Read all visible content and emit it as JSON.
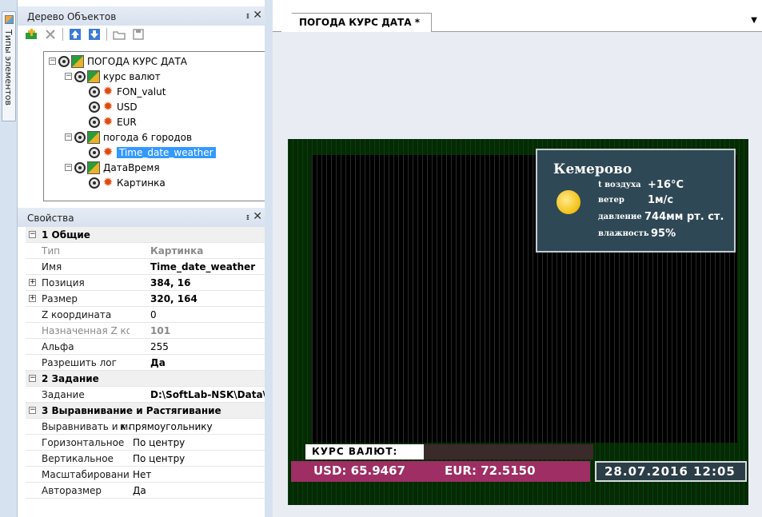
{
  "rail": {
    "label": "Типы элементов",
    "icon": "elements-icon"
  },
  "tree_panel": {
    "title": "Дерево Объектов",
    "pin": "ᵻ",
    "close": "✕",
    "toolbar": [
      "add-element-icon",
      "delete-icon",
      "move-up-icon",
      "move-down-icon",
      "open-icon",
      "save-icon"
    ],
    "nodes": [
      {
        "label": "ПОГОДА КУРС ДАТА",
        "level": 0,
        "expander": "−",
        "kind": "root"
      },
      {
        "label": "курс валют",
        "level": 1,
        "expander": "−",
        "kind": "group"
      },
      {
        "label": "FON_valut",
        "level": 2,
        "kind": "item"
      },
      {
        "label": "USD",
        "level": 2,
        "kind": "item"
      },
      {
        "label": "EUR",
        "level": 2,
        "kind": "item"
      },
      {
        "label": "погода 6 городов",
        "level": 1,
        "expander": "−",
        "kind": "group"
      },
      {
        "label": "Time_date_weather",
        "level": 2,
        "kind": "item",
        "selected": true
      },
      {
        "label": "ДатаВремя",
        "level": 1,
        "expander": "−",
        "kind": "group"
      },
      {
        "label": "Картинка",
        "level": 2,
        "kind": "item"
      }
    ]
  },
  "props_panel": {
    "title": "Свойства",
    "pin": "ᵻ",
    "close": "✕",
    "rows": [
      {
        "type": "cat",
        "name": "1 Общие",
        "expander": "−"
      },
      {
        "type": "prop",
        "name": "Тип",
        "value": "Картинка",
        "dim": true,
        "bold": true
      },
      {
        "type": "prop",
        "name": "Имя",
        "value": "Time_date_weather",
        "bold": true
      },
      {
        "type": "prop",
        "name": "Позиция",
        "value": "384, 16",
        "bold": true,
        "expander": "+"
      },
      {
        "type": "prop",
        "name": "Размер",
        "value": "320, 164",
        "bold": true,
        "expander": "+"
      },
      {
        "type": "prop",
        "name": "Z координата",
        "value": "0"
      },
      {
        "type": "prop",
        "name": "Назначенная Z коо",
        "value": "101",
        "dim": true,
        "bold": true
      },
      {
        "type": "prop",
        "name": "Альфа",
        "value": "255"
      },
      {
        "type": "prop",
        "name": "Разрешить лог",
        "value": "Да",
        "bold": true
      },
      {
        "type": "cat",
        "name": "2 Задание",
        "expander": "−"
      },
      {
        "type": "prop",
        "name": "Задание",
        "value": "D:\\SoftLab-NSK\\Data\\",
        "bold": true
      },
      {
        "type": "cat",
        "name": "3 Выравнивание и Растягивание",
        "expander": "−"
      },
      {
        "type": "prop",
        "name": "Выравнивать и мас",
        "value": "к прямоугольнику"
      },
      {
        "type": "prop",
        "name": "Горизонтальное",
        "value": "По центру"
      },
      {
        "type": "prop",
        "name": "Вертикальное",
        "value": "По центру"
      },
      {
        "type": "prop",
        "name": "Масштабирование",
        "value": "Нет"
      },
      {
        "type": "prop",
        "name": "Авторазмер",
        "value": "Да"
      }
    ]
  },
  "document": {
    "tab_label": "ПОГОДА КУРС ДАТА *",
    "tab_menu": "▼"
  },
  "display": {
    "weather": {
      "city": "Кемерово",
      "temp_label": "t воздуха",
      "temp_value": "+16°C",
      "wind_label": "ветер",
      "wind_value": "1м/с",
      "pressure_label": "давление",
      "pressure_value": "744мм рт. ст.",
      "humidity_label": "влажность",
      "humidity_value": "95%"
    },
    "currency": {
      "label": "КУРС ВАЛЮТ:",
      "usd": "USD: 65.9467",
      "eur": "EUR: 72.5150"
    },
    "datetime": "28.07.2016 12:05"
  },
  "colors": {
    "selection": "#3399ff",
    "currency_bar": "#9e2e63",
    "weather_box": "#2f4856",
    "datetime_box": "#2b3d47",
    "led_border": "#062906"
  }
}
